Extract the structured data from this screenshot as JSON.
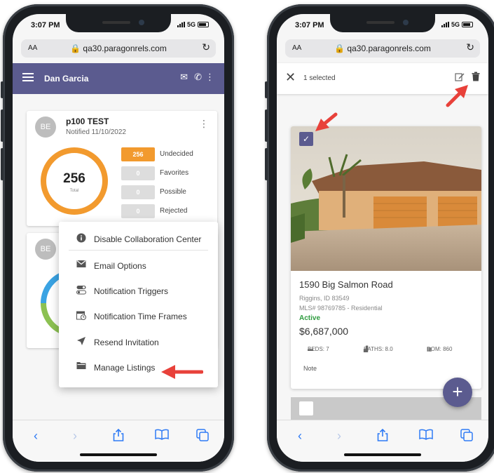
{
  "left_phone": {
    "status_time": "3:07 PM",
    "network": "5G",
    "url_aa": "AA",
    "url": "qa30.paragonrels.com",
    "user_name": "Dan Garcia",
    "card1": {
      "avatar": "BE",
      "title": "p100 TEST",
      "subtitle": "Notified 11/10/2022",
      "total_value": "256",
      "total_label": "Total",
      "stats": [
        {
          "value": "256",
          "label": "Undecided"
        },
        {
          "value": "0",
          "label": "Favorites"
        },
        {
          "value": "0",
          "label": "Possible"
        },
        {
          "value": "0",
          "label": "Rejected"
        }
      ]
    },
    "card2": {
      "avatar": "BE"
    },
    "menu": [
      {
        "icon": "info-icon",
        "label": "Disable Collaboration Center"
      },
      {
        "icon": "mail-icon",
        "label": "Email Options"
      },
      {
        "icon": "toggle-icon",
        "label": "Notification Triggers"
      },
      {
        "icon": "calendar-clock-icon",
        "label": "Notification Time Frames"
      },
      {
        "icon": "send-icon",
        "label": "Resend Invitation"
      },
      {
        "icon": "folder-icon",
        "label": "Manage Listings"
      }
    ]
  },
  "right_phone": {
    "status_time": "3:07 PM",
    "network": "5G",
    "url_aa": "AA",
    "url": "qa30.paragonrels.com",
    "selected_text": "1 selected",
    "listing": {
      "address": "1590 Big Salmon Road",
      "location": "Riggins, ID 83549",
      "mls": "MLS# 98769785 - Residential",
      "status": "Active",
      "price": "$6,687,000",
      "beds": "BEDS: 7",
      "baths": "BATHS: 8.0",
      "dom": "DOM: 860",
      "note": "Note"
    }
  },
  "colors": {
    "appbar": "#5b5b8f",
    "accent_orange": "#f29a2e",
    "ring_blue": "#3aa3e3",
    "ring_green": "#8cc152",
    "active_green": "#2e9b3f",
    "arrow_red": "#e8413a",
    "ios_blue": "#2f7bf5"
  }
}
